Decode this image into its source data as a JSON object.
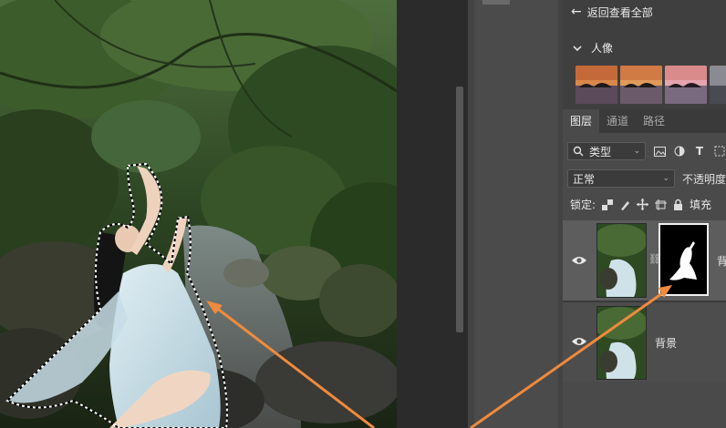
{
  "panel": {
    "back_label": "返回查看全部",
    "section_label": "人像"
  },
  "layers_tabs": [
    "图层",
    "通道",
    "路径"
  ],
  "filter": {
    "kind_label": "类型"
  },
  "blend": {
    "mode": "正常",
    "opacity_label": "不透明度"
  },
  "lock": {
    "label": "锁定:",
    "fill_label": "填充"
  },
  "layers": [
    {
      "name": "背",
      "has_mask": true
    },
    {
      "name": "背景",
      "has_mask": false
    }
  ],
  "icons": {
    "back": "arrow-left-icon",
    "expand": "chevron-down-icon",
    "search": "search-icon",
    "eye": "eye-icon",
    "link": "chain-link-icon",
    "lock": "lock-icon"
  },
  "colors": {
    "arrow": "#f08a3c",
    "panel": "#4a4a4a",
    "active_layer": "#5d5d5d"
  }
}
